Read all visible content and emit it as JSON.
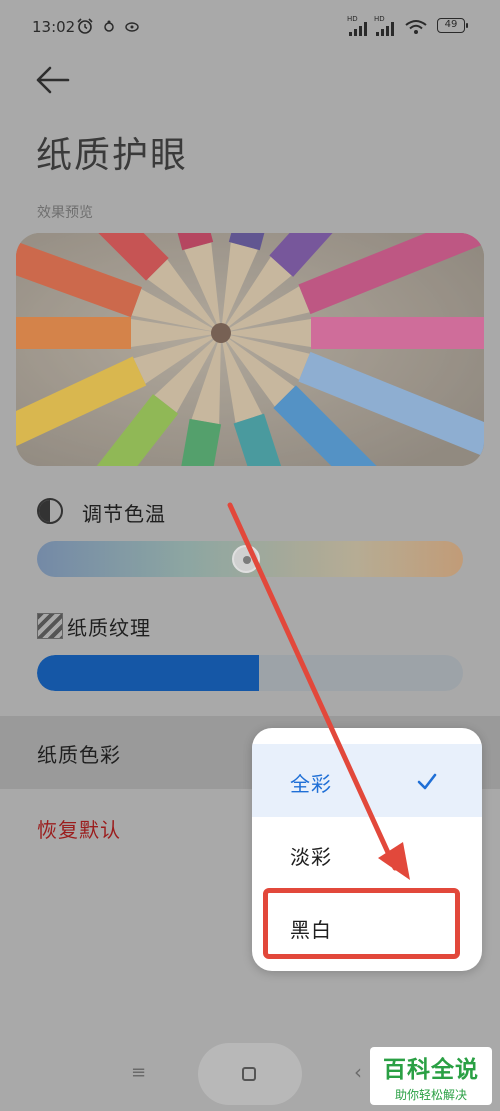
{
  "status_bar": {
    "time": "13:02",
    "signal1_label": "HD",
    "signal2_label": "HD",
    "battery": "49"
  },
  "header": {
    "back_icon": "arrow-left-icon",
    "title": "纸质护眼"
  },
  "preview": {
    "label": "效果预览",
    "image_subject": "colored-pencils-photo"
  },
  "color_temperature": {
    "label": "调节色温",
    "icon": "half-circle-icon",
    "value": 0.49
  },
  "paper_texture": {
    "label": "纸质纹理",
    "icon": "texture-stripes-icon",
    "value": 0.52
  },
  "paper_color": {
    "label": "纸质色彩"
  },
  "restore_default": {
    "label": "恢复默认",
    "color": "#9b1d1d"
  },
  "popup": {
    "options": [
      {
        "label": "全彩",
        "selected": true
      },
      {
        "label": "淡彩",
        "selected": false
      },
      {
        "label": "黑白",
        "selected": false
      }
    ],
    "accent_color": "#1f6fd6",
    "highlight_color": "#e2483b"
  },
  "nav": {
    "menu_icon": "menu-lines-icon",
    "menu_glyph": "≡",
    "home_icon": "square-home-icon",
    "back_icon": "chevron-left-icon",
    "back_glyph": "‹"
  },
  "watermark": {
    "main": "百科全说",
    "sub": "助你轻松解决"
  }
}
